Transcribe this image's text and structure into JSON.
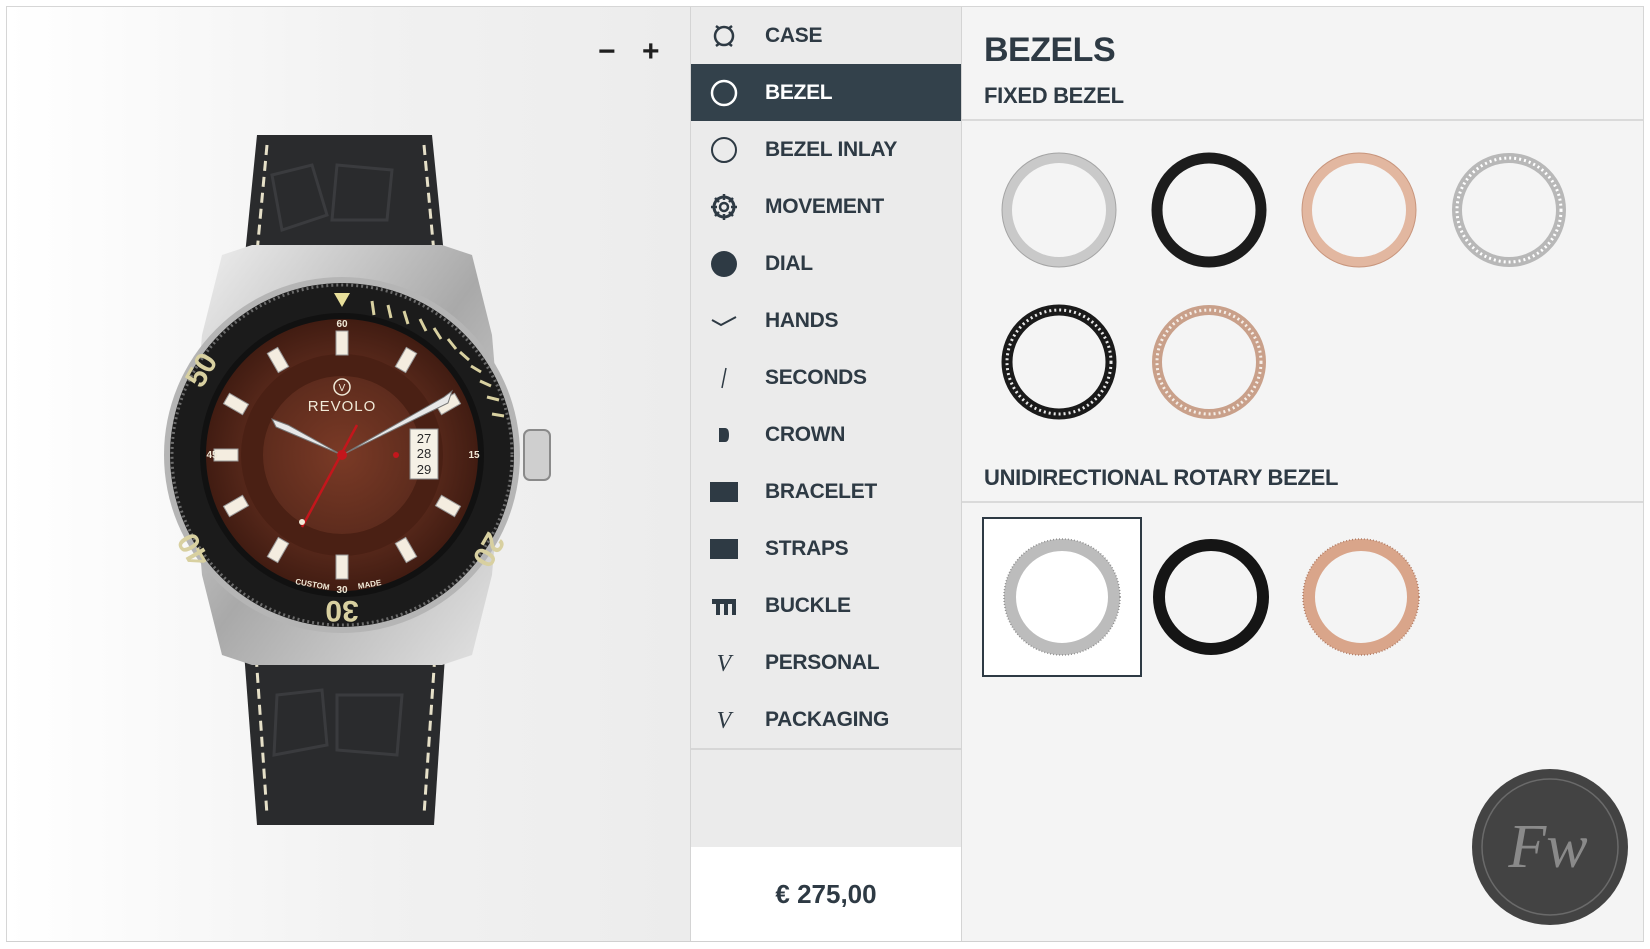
{
  "preview": {
    "zoom_out": "−",
    "zoom_in": "+",
    "watch": {
      "brand": "REVOLO",
      "brand_mark": "V",
      "dial_text_bottom_left": "CUSTOM",
      "dial_text_bottom_right": "MADE",
      "date_window": [
        "27",
        "28",
        "29"
      ],
      "bezel_numerals": [
        "50",
        "40",
        "30",
        "20"
      ],
      "minute_numerals": [
        "60",
        "15",
        "30",
        "45"
      ],
      "colors": {
        "dial": "#5a2a1c",
        "bezel": "#1b1b1b",
        "bezel_numerals": "#d8d0a0",
        "strap": "#2a2b2d",
        "seconds_hand": "#c4161c"
      }
    }
  },
  "menu": {
    "items": [
      {
        "label": "CASE",
        "icon": "case-icon",
        "active": false
      },
      {
        "label": "BEZEL",
        "icon": "bezel-icon",
        "active": true
      },
      {
        "label": "BEZEL INLAY",
        "icon": "bezel-inlay-icon",
        "active": false
      },
      {
        "label": "MOVEMENT",
        "icon": "movement-icon",
        "active": false
      },
      {
        "label": "DIAL",
        "icon": "dial-icon",
        "active": false
      },
      {
        "label": "HANDS",
        "icon": "hands-icon",
        "active": false
      },
      {
        "label": "SECONDS",
        "icon": "seconds-icon",
        "active": false
      },
      {
        "label": "CROWN",
        "icon": "crown-icon",
        "active": false
      },
      {
        "label": "BRACELET",
        "icon": "bracelet-icon",
        "active": false
      },
      {
        "label": "STRAPS",
        "icon": "straps-icon",
        "active": false
      },
      {
        "label": "BUCKLE",
        "icon": "buckle-icon",
        "active": false
      },
      {
        "label": "PERSONAL",
        "icon": "personal-icon",
        "active": false
      },
      {
        "label": "PACKAGING",
        "icon": "packaging-icon",
        "active": false
      }
    ],
    "price": "€ 275,00"
  },
  "panel": {
    "title": "BEZELS",
    "fixed": {
      "heading": "FIXED BEZEL",
      "options": [
        {
          "name": "steel",
          "color": "#c9c9c9"
        },
        {
          "name": "black",
          "color": "#1c1c1c"
        },
        {
          "name": "rose-gold",
          "color": "#e2b7a0"
        },
        {
          "name": "steel-stones",
          "color": "#b8b8b8"
        },
        {
          "name": "black-stones",
          "color": "#1a1a1a"
        },
        {
          "name": "rose-gold-stones",
          "color": "#c9a08a"
        }
      ]
    },
    "rotary": {
      "heading": "UNIDIRECTIONAL ROTARY BEZEL",
      "options": [
        {
          "name": "steel",
          "color": "#bcbcbc",
          "selected": true
        },
        {
          "name": "black",
          "color": "#151515",
          "selected": false
        },
        {
          "name": "rose-gold",
          "color": "#d9a58a",
          "selected": false
        }
      ]
    },
    "watermark": "Fw"
  }
}
